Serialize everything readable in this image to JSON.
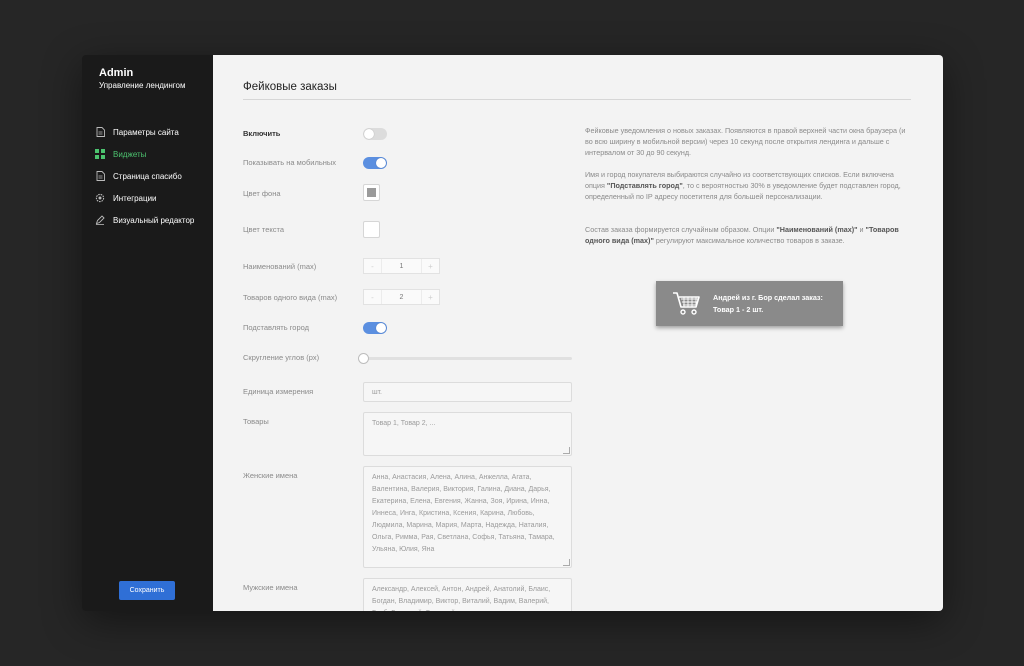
{
  "sidebar": {
    "title": "Admin",
    "subtitle": "Управление лендингом",
    "items": [
      {
        "label": "Параметры сайта",
        "icon": "document-icon",
        "active": false
      },
      {
        "label": "Виджеты",
        "icon": "grid-icon",
        "active": true
      },
      {
        "label": "Страница спасибо",
        "icon": "document-icon",
        "active": false
      },
      {
        "label": "Интеграции",
        "icon": "gear-icon",
        "active": false
      },
      {
        "label": "Визуальный редактор",
        "icon": "pen-icon",
        "active": false
      }
    ],
    "save_label": "Сохранить"
  },
  "main": {
    "title": "Фейковые заказы",
    "fields": {
      "enable": {
        "label": "Включить",
        "on": false
      },
      "mobile": {
        "label": "Показывать на мобильных",
        "on": true
      },
      "bg_color": {
        "label": "Цвет фона",
        "value": "#9a9a9a"
      },
      "text_color": {
        "label": "Цвет текста",
        "value": "#ffffff"
      },
      "names_max": {
        "label": "Наименований (max)",
        "value": "1",
        "minus": "-",
        "plus": "+"
      },
      "same_max": {
        "label": "Товаров одного вида (max)",
        "value": "2",
        "minus": "-",
        "plus": "+"
      },
      "city": {
        "label": "Подставлять город",
        "on": true
      },
      "radius": {
        "label": "Скругление углов (px)",
        "value": 0
      },
      "unit": {
        "label": "Единица измерения",
        "placeholder": "шт."
      },
      "goods": {
        "label": "Товары",
        "placeholder": "Товар 1, Товар 2, ..."
      },
      "female": {
        "label": "Женские имена",
        "value": "Анна, Анастасия, Алена, Алина, Анжелла, Агата, Валентина, Валерия, Виктория, Галина, Диана, Дарья, Екатерина, Елена, Евгения, Жанна, Зоя, Ирина, Инна, Иннеса, Инга, Кристина, Ксения, Карина, Любовь, Людмила, Марина, Мария, Марта, Надежда, Наталия, Ольга, Римма, Рая, Светлана, Софья, Татьяна, Тамара, Ульяна, Юлия, Яна"
      },
      "male": {
        "label": "Мужские имена",
        "value": "Александр, Алексей, Антон, Андрей, Анатолий, Блаис, Богдан, Владимир, Виктор, Виталий, Вадим, Валерий, Глеб, Геннадий, Григорий"
      }
    },
    "description": {
      "p1": "Фейковые уведомления о новых заказах. Появляются в правой верхней части окна браузера (и во всю ширину в мобильной версии) через 10 секунд после открытия лендинга и дальше с интервалом от 30 до 90 секунд.",
      "p2_pre": "Имя и город покупателя выбираются случайно из соответствующих списков. Если включена опция ",
      "p2_bold": "\"Подставлять город\"",
      "p2_post": ", то с вероятностью 30% в уведомление будет подставлен город, определенный по IP адресу посетителя для большей персонализации.",
      "p3_pre": "Состав заказа формируется случайным образом. Опции ",
      "p3_bold1": "\"Наименований (max)\"",
      "p3_mid": " и ",
      "p3_bold2": "\"Товаров одного вида (max)\"",
      "p3_post": " регулируют максимальное количество товаров в заказе."
    },
    "preview": {
      "line1": "Андрей из г. Бор сделал заказ:",
      "line2": "Товар 1 - 2 шт.",
      "icon": "cart-icon"
    }
  },
  "colors": {
    "accent_green": "#4cc36f",
    "toggle_on": "#5b8fe0",
    "save_button": "#2f6fd6",
    "preview_bg": "#8a8a8a"
  }
}
